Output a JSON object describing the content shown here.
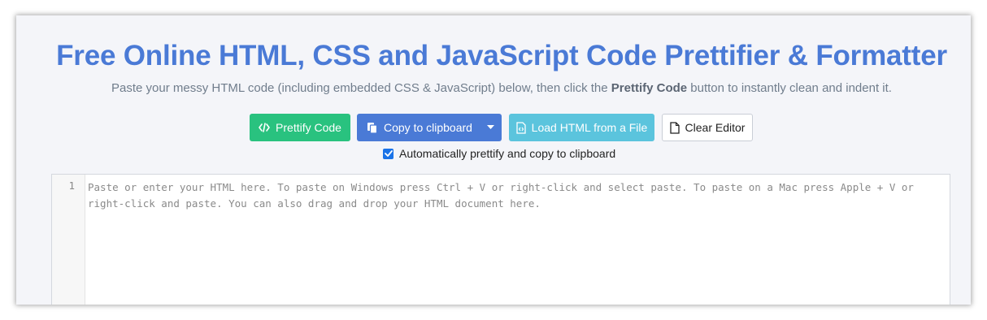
{
  "header": {
    "title": "Free Online HTML, CSS and JavaScript Code Prettifier & Formatter",
    "subtitle_prefix": "Paste your messy HTML code (including embedded CSS & JavaScript) below, then click the ",
    "subtitle_bold": "Prettify Code",
    "subtitle_suffix": " button to instantly clean and indent it."
  },
  "toolbar": {
    "prettify_label": "Prettify Code",
    "copy_label": "Copy to clipboard",
    "load_label": "Load HTML from a File",
    "clear_label": "Clear Editor"
  },
  "options": {
    "auto_label": "Automatically prettify and copy to clipboard",
    "auto_checked": true
  },
  "editor": {
    "line_number": "1",
    "placeholder": "Paste or enter your HTML here. To paste on Windows press Ctrl + V or right-click and select paste. To paste on a Mac press Apple + V or right-click and paste. You can also drag and drop your HTML document here."
  },
  "colors": {
    "title": "#4a7ad6",
    "prettify_button": "#29c27f",
    "copy_button": "#4a7ad6",
    "load_button": "#5bc4dd",
    "checkbox": "#1a73e8"
  },
  "icons": {
    "prettify": "code-icon",
    "copy": "copy-icon",
    "copy_dropdown": "caret-down-icon",
    "load": "file-code-icon",
    "clear": "file-icon",
    "checkbox": "check-icon"
  }
}
